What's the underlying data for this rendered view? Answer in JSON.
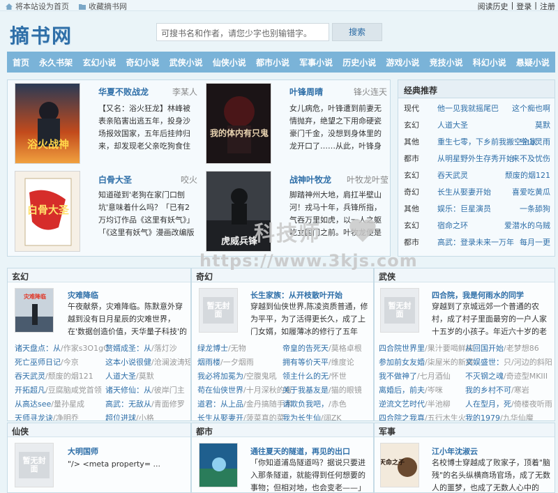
{
  "topbar": {
    "set_home": "将本站设为首页",
    "bookmark": "收藏摘书网",
    "history": "阅读历史",
    "sep": "|",
    "login": "登录",
    "register": "注册"
  },
  "header": {
    "logo": "摘书网",
    "search_placeholder": "可搜书名和作者，请您少字也别输错字。",
    "search_button": "搜索"
  },
  "nav": [
    "首页",
    "永久书架",
    "玄幻小说",
    "奇幻小说",
    "武侠小说",
    "仙侠小说",
    "都市小说",
    "军事小说",
    "历史小说",
    "游戏小说",
    "竞技小说",
    "科幻小说",
    "悬疑小说"
  ],
  "featured": [
    {
      "title": "华夏不败战龙",
      "author": "李某人",
      "desc": "【又名：浴火狂龙】林峰被表亲陷害出逃五年，投身沙场报效国家，五年后挂帅归来，却发现老父亲吃狗食住狗窝，美娇妻打工刷马",
      "cover_text": "浴火战神"
    },
    {
      "title": "叶锋周晴",
      "author": "锋火连天",
      "desc": "女儿病危，叶锋遭到前妻无情抛弃，绝望之下用命硬瓷豪门千金，没想到身体里的龙开口了……从此，叶锋身怀龙脉，驰骋都市！",
      "cover_text": "我的体内有只鬼"
    },
    {
      "title": "白骨大圣",
      "author": "咬火",
      "desc": "知道碰到'老狗在家门口刨坑'意味着什么吗？「已有2万均订作品《这里有妖气》」「《这里有妖气》漫画改编版权已卖出」",
      "cover_text": "白骨大圣"
    },
    {
      "title": "战神叶牧龙",
      "author": "叶牧龙叶莹",
      "desc": "脚踏神州大地，肩扛半壁山河！戎马十年，兵锋所指，气吞万里如虎，以一人之躯屹立国门之前。叶牧龙便是那兵锋所指的神！",
      "cover_text": "虎威兵锋"
    }
  ],
  "recommend": {
    "title": "经典推荐",
    "items": [
      {
        "cat": "现代",
        "title": "他一见我就摇尾巴",
        "author": "这个痴也啊"
      },
      {
        "cat": "玄幻",
        "title": "人道大圣",
        "author": "莫默"
      },
      {
        "cat": "其他",
        "title": "重生七零，下乡前我搬空全家",
        "author": "空山灵雨"
      },
      {
        "cat": "都市",
        "title": "从明星野外生存秀开始",
        "author": "来不及忧伤"
      },
      {
        "cat": "玄幻",
        "title": "吞天武灵",
        "author": "颓废的烟121"
      },
      {
        "cat": "奇幻",
        "title": "长生从娶妻开始",
        "author": "喜爱吃黄瓜"
      },
      {
        "cat": "其他",
        "title": "娱乐：巨星演员",
        "author": "一条舔狗"
      },
      {
        "cat": "玄幻",
        "title": "宿命之环",
        "author": "爱潜水的乌贼"
      },
      {
        "cat": "都市",
        "title": "高武：登录未来一万年",
        "author": "每月一更"
      }
    ]
  },
  "sections": [
    {
      "name": "玄幻",
      "lead_title": "灾难降临",
      "lead_desc": "午夜献祭，灾难降临。陈默意外穿越到没有日月星辰的灾难世界，在'数据创造价值，天华量子科技'的神秘广告中开启新",
      "cover_text": "灾难降临",
      "list": [
        {
          "a": "诸天盘点：从",
          "a2": "/作家s3O1gC",
          "b": "赘婿成圣：从",
          "b2": "/落灯沙"
        },
        {
          "a": "死亡巫师日记",
          "a2": "/今京",
          "b": "这本小说很健",
          "b2": "/沧澜波涛短"
        },
        {
          "a": "吞天武灵",
          "a2": "/颓废的烟121",
          "b": "人道大圣",
          "b2": "/莫默"
        },
        {
          "a": "开拓超凡",
          "a2": "/豆腐脑咸党首领",
          "b": "诸天修仙：从",
          "b2": "/彼岸门主"
        },
        {
          "a": "从高达see",
          "a2": "/量孙星成",
          "b": "高武：无敌从",
          "b2": "/青面修罗"
        },
        {
          "a": "天师寻龙诀",
          "a2": "/净明乔",
          "b": "超位进球",
          "b2": "/小格"
        }
      ]
    },
    {
      "name": "奇幻",
      "lead_title": "长生家族：从开枝散叶开始",
      "lead_desc": "穿越到仙侠世界,陈凌资质普通，修为平平，为了活得更长久，成了上门女婿，如履薄冰的修行了五年多，可没有金手指的",
      "cover_text": "暂无封面",
      "list": [
        {
          "a": "绿龙博士",
          "a2": "/无物",
          "b": "帝皇的告死天",
          "b2": "/莫格卓根"
        },
        {
          "a": "烟雨楼",
          "a2": "/一夕烟雨",
          "b": "拥有等价天平",
          "b2": "/维度论"
        },
        {
          "a": "我必将加冕为",
          "a2": "/空腹鬼吼",
          "b": "领主什么的无",
          "b2": "/怀世"
        },
        {
          "a": "苟在仙侠世界",
          "a2": "/十月深秋的蜜",
          "b": "关于我基友是",
          "b2": "/猫的眼镜"
        },
        {
          "a": "道君：从上品",
          "a2": "/金丹搞随手术",
          "b": "请欺负我吧，",
          "b2": "/赤色"
        },
        {
          "a": "长生从娶妻开",
          "a2": "/菠菜真的菜",
          "b": "我为长生仙",
          "b2": "/阔ZK"
        }
      ]
    },
    {
      "name": "武侠",
      "lead_title": "四合院，我是何雨水的同学",
      "lead_desc": "穿越到了京城远郊一个普通的农村，成了村子里面最穷的一户人家十五岁的小孩子。年近六十岁的老爹，裹着小脚的老娘",
      "cover_text": "暂无封面",
      "list": [
        {
          "a": "四合院世界里",
          "a2": "/果汁要喝鲜榨",
          "b": "从回国开始",
          "b2": "/老梦想86"
        },
        {
          "a": "参加前女友婚",
          "a2": "/柒屋米的新裤",
          "b": "文娱盛世：",
          "b2": "只/河边的斜阳"
        },
        {
          "a": "我不做神了",
          "a2": "/七月酒仙",
          "b": "不灭钢之魂",
          "b2": "/奇迹型MKIII"
        },
        {
          "a": "离婚后，前夫",
          "a2": "/岑咪",
          "b": "我的乡村不可",
          "b2": "/寒岩"
        },
        {
          "a": "逆流文艺时代",
          "a2": "/半池柳",
          "b": "人在型月，死",
          "b2": "/倚楼夜听雨"
        },
        {
          "a": "四合院之我真",
          "a2": "/五行木生火",
          "b": "我的1979",
          "b2": "/九华仙魔"
        }
      ]
    },
    {
      "name": "仙侠",
      "lead_title": "大明国师",
      "lead_desc": "\"/> <meta property= ...",
      "cover_text": "暂无封面"
    },
    {
      "name": "都市",
      "lead_title": "通往夏天的隧道，再见的出口",
      "lead_desc": "「你知道浦岛隧道吗？据说只要进入那条隧道，就能得到任何想要的事物；但相对地，也会变老——」 高中生塔野薰听过了",
      "cover_text": ""
    },
    {
      "name": "军事",
      "lead_title": "江小年沈淑云",
      "lead_desc": "名校博士穿越成了败家子，顶着\"脑残\"的名头纵横商场官场，成了无数人的噩梦，也成了无数人心中的神。…… 无数人…",
      "cover_text": "天命之子"
    }
  ],
  "watermark": {
    "line1": "科技师",
    "line2": "https://www.3kjs.com"
  }
}
